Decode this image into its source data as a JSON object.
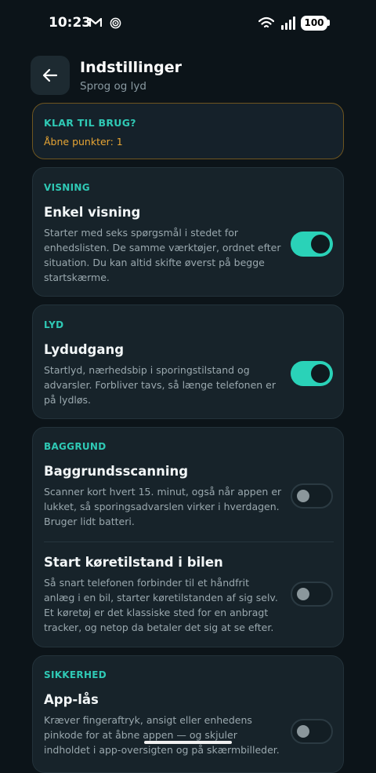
{
  "status_bar": {
    "time": "10:23",
    "battery": "100"
  },
  "header": {
    "title": "Indstillinger",
    "subtitle": "Sprog og lyd"
  },
  "banner": {
    "heading": "KLAR TIL BRUG?",
    "text": "Åbne punkter: 1"
  },
  "sections": {
    "display": {
      "label": "VISNING",
      "items": [
        {
          "title": "Enkel visning",
          "desc": "Starter med seks spørgsmål i stedet for enhedslisten. De samme værktøjer, ordnet efter situation. Du kan altid skifte øverst på begge startskærme.",
          "enabled": true
        }
      ]
    },
    "sound": {
      "label": "LYD",
      "items": [
        {
          "title": "Lydudgang",
          "desc": "Startlyd, nærhedsbip i sporingstilstand og advarsler. Forbliver tavs, så længe telefonen er på lydløs.",
          "enabled": true
        }
      ]
    },
    "background": {
      "label": "BAGGRUND",
      "items": [
        {
          "title": "Baggrundsscanning",
          "desc": "Scanner kort hvert 15. minut, også når appen er lukket, så sporingsadvarslen virker i hverdagen. Bruger lidt batteri.",
          "enabled": false
        },
        {
          "title": "Start køretilstand i bilen",
          "desc": "Så snart telefonen forbinder til et håndfrit anlæg i en bil, starter køretilstanden af sig selv. Et køretøj er det klassiske sted for en anbragt tracker, og netop da betaler det sig at se efter.",
          "enabled": false
        }
      ]
    },
    "security": {
      "label": "SIKKERHED",
      "items": [
        {
          "title": "App-lås",
          "desc": "Kræver fingeraftryk, ansigt eller enhedens pinkode for at åbne appen — og skjuler indholdet i app-oversigten og på skærmbilleder.",
          "enabled": false
        }
      ]
    }
  },
  "colors": {
    "accent": "#2fc9b5",
    "warning": "#e7a534",
    "background": "#0c1419",
    "card": "#17232a"
  }
}
